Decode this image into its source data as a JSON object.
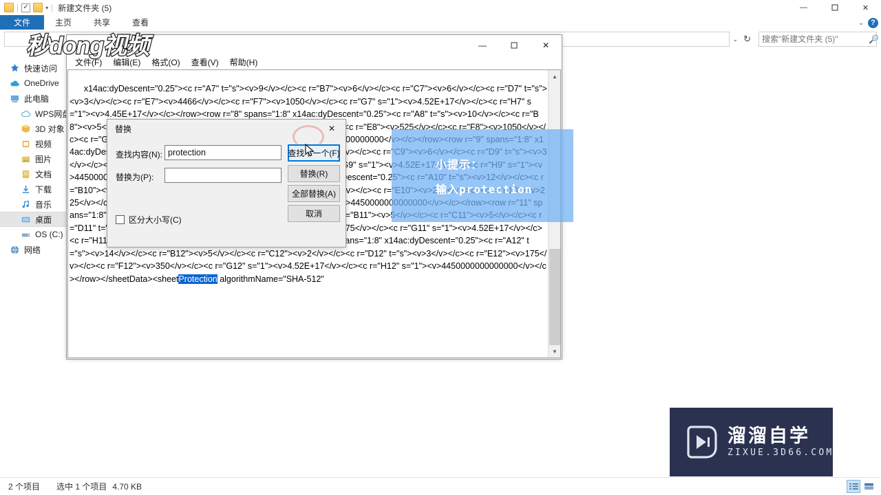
{
  "explorer": {
    "quick_access_title": "新建文件夹 (5)",
    "quick_access_icons": [
      "folder-icon",
      "checkbox-icon",
      "folder-icon",
      "dropdown-caret-icon"
    ],
    "window_controls": {
      "minimize": "—",
      "maximize": "❐",
      "close": "✕"
    },
    "ribbon_tabs": [
      {
        "label": "文件",
        "active": true
      },
      {
        "label": "主页",
        "active": false
      },
      {
        "label": "共享",
        "active": false
      },
      {
        "label": "查看",
        "active": false
      }
    ],
    "help_icon": "?",
    "address_caret": "⌄",
    "refresh_icon": "↻",
    "search_placeholder": "搜索\"新建文件夹 (5)\"",
    "search_value": "",
    "search_icon": "search-icon",
    "nav_items": [
      {
        "label": "快速访问",
        "icon": "pin-star-icon",
        "level": 1,
        "selected": false
      },
      {
        "label": "OneDrive",
        "icon": "cloud-icon",
        "level": 1,
        "selected": false
      },
      {
        "label": "此电脑",
        "icon": "computer-icon",
        "level": 1,
        "selected": false
      },
      {
        "label": "WPS网盘",
        "icon": "cloud-outline-icon",
        "level": 2,
        "selected": false
      },
      {
        "label": "3D 对象",
        "icon": "cube-icon",
        "level": 2,
        "selected": false
      },
      {
        "label": "视频",
        "icon": "video-icon",
        "level": 2,
        "selected": false
      },
      {
        "label": "图片",
        "icon": "picture-icon",
        "level": 2,
        "selected": false
      },
      {
        "label": "文档",
        "icon": "document-icon",
        "level": 2,
        "selected": false
      },
      {
        "label": "下载",
        "icon": "download-icon",
        "level": 2,
        "selected": false
      },
      {
        "label": "音乐",
        "icon": "music-icon",
        "level": 2,
        "selected": false
      },
      {
        "label": "桌面",
        "icon": "desktop-icon",
        "level": 2,
        "selected": true
      },
      {
        "label": "OS (C:)",
        "icon": "drive-icon",
        "level": 2,
        "selected": false
      },
      {
        "label": "网络",
        "icon": "network-icon",
        "level": 1,
        "selected": false
      }
    ],
    "status": {
      "item_count": "2 个项目",
      "selection": "选中 1 个项目",
      "size": "4.70 KB"
    },
    "view_buttons": [
      "details-view-icon",
      "large-icons-view-icon"
    ]
  },
  "notepad": {
    "menu": [
      {
        "label": "文件(F)"
      },
      {
        "label": "编辑(E)"
      },
      {
        "label": "格式(O)"
      },
      {
        "label": "查看(V)"
      },
      {
        "label": "帮助(H)"
      }
    ],
    "window_controls": {
      "minimize": "—",
      "maximize": "▢",
      "close": "✕"
    },
    "scroll_up_icon": "▲",
    "scroll_down_icon": "▼",
    "text_before_highlight": "x14ac:dyDescent=\"0.25\"><c r=\"A7\" t=\"s\"><v>9</v></c><c r=\"B7\"><v>6</v></c><c r=\"C7\"><v>6</v></c><c r=\"D7\" t=\"s\"><v>3</v></c><c r=\"E7\"><v>4466</v></c><c r=\"F7\"><v>1050</v></c><c r=\"G7\" s=\"1\"><v>4.52E+17</v></c><c r=\"H7\" s=\"1\"><v>4.45E+17</v></c></row><row r=\"8\" spans=\"1:8\" x14ac:dyDescent=\"0.25\"><c r=\"A8\" t=\"s\"><v>10</v></c><c r=\"B8\"><v>5</v></c><c r=\"C8\"><v>3</v></c><c r=\"D8\" t=\"s\"><v>3</v></c><c r=\"E8\"><v>525</v></c><c r=\"F8\"><v>1050</v></c><c r=\"G8\" s=\"1\"><v>4.52E+17</v></c><c r=\"H8\" s=\"1\"><v>4450000000000000</v></c></row><row r=\"9\" spans=\"1:8\" x14ac:dyDescent=\"0.25\"><c r=\"A9\" t=\"s\"><v>11</v></c><c r=\"B9\"><v>8</v></c><c r=\"C9\"><v>6</v></c><c r=\"D9\" t=\"s\"><v>3</v></c><c r=\"E9\"><v>4556</v></c><c r=\"F9\"><v>2800</v></c><c r=\"G9\" s=\"1\"><v>4.52E+17</v></c><c r=\"H9\" s=\"1\"><v>4450000000000000</v></c></row><row r=\"10\" spans=\"1:8\" x14ac:dyDescent=\"0.25\"><c r=\"A10\" t=\"s\"><v>12</v></c><c r=\"B10\"><v>1</v></c><c r=\"C10\"><v>1</v></c><c r=\"D10\" t=\"s\"><v>3</v></c><c r=\"E10\"><v>225</v></c><c r=\"F10\"><v>225</v></c><c r=\"G10\" s=\"1\"><v>4.52E+17</v></c><c r=\"H10\" s=\"1\"><v>4450000000000000</v></c></row><row r=\"11\" spans=\"1:8\" x14ac:dyDescent=\"0.25\"><c r=\"A11\" t=\"s\"><v>13</v></c><c r=\"B11\"><v>5</v></c><c r=\"C11\"><v>5</v></c><c r=\"D11\" t=\"s\"><v>3</v></c><c r=\"E11\"><v>175</v></c><c r=\"F11\"><v>875</v></c><c r=\"G11\" s=\"1\"><v>4.52E+17</v></c><c r=\"H11\" s=\"1\"><v>4450000000000000</v></c></row><row r=\"12\" spans=\"1:8\" x14ac:dyDescent=\"0.25\"><c r=\"A12\" t=\"s\"><v>14</v></c><c r=\"B12\"><v>5</v></c><c r=\"C12\"><v>2</v></c><c r=\"D12\" t=\"s\"><v>3</v></c><c r=\"E12\"><v>175</v></c><c r=\"F12\"><v>350</v></c><c r=\"G12\" s=\"1\"><v>4.52E+17</v></c><c r=\"H12\" s=\"1\"><v>4450000000000000</v></c></row></sheetData><sheet",
    "highlighted_text": "Protection",
    "text_after_highlight": " algorithmName=\"SHA-512\""
  },
  "dialog": {
    "title": "替换",
    "close_icon": "✕",
    "find_label": "查找内容(N):",
    "find_value": "protection",
    "replace_label": "替换为(P):",
    "replace_value": "",
    "buttons": [
      {
        "label": "查找下一个(F)",
        "focused": true
      },
      {
        "label": "替换(R)",
        "focused": false
      },
      {
        "label": "全部替换(A)",
        "focused": false
      },
      {
        "label": "取消",
        "focused": false
      }
    ],
    "checkbox_label": "区分大小写(C)",
    "checkbox_checked": false
  },
  "tooltip": {
    "line1": "小提示：",
    "line2": "输入protection",
    "background_color": "#6eaff5"
  },
  "watermarks": {
    "top_text": "秒dong视频",
    "bottom_title": "溜溜自学",
    "bottom_url": "ZIXUE.3D66.COM",
    "bottom_bg": "#2b3250"
  }
}
